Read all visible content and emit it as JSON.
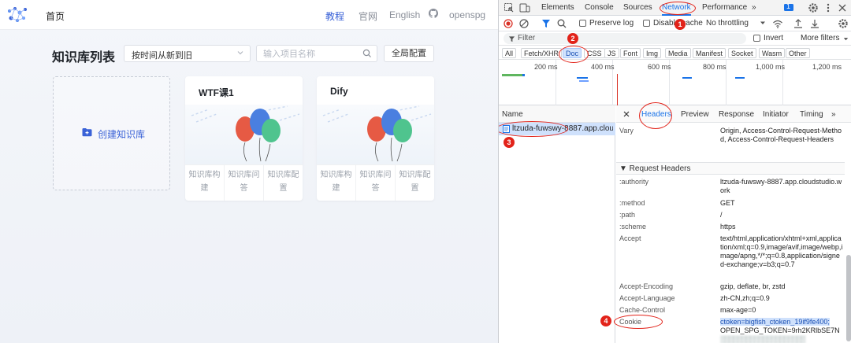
{
  "app": {
    "nav": {
      "home": "首页",
      "tutorial": "教程",
      "site": "官网",
      "lang": "English",
      "openspg": "openspg"
    },
    "list_title": "知识库列表",
    "sort_value": "按时间从新到旧",
    "search_placeholder": "输入项目名称",
    "global_config": "全局配置",
    "create_label": "创建知识库",
    "cards": [
      {
        "name": "WTF课1",
        "actions": [
          "知识库构建",
          "知识库问答",
          "知识库配置"
        ]
      },
      {
        "name": "Dify",
        "actions": [
          "知识库构建",
          "知识库问答",
          "知识库配置"
        ]
      }
    ],
    "colors": {
      "accent": "#3a62d7"
    }
  },
  "devtools": {
    "tabs": [
      "Elements",
      "Console",
      "Sources",
      "Network",
      "Performance",
      "»"
    ],
    "active_tab": "Network",
    "issue_badge": "1",
    "toolbar": {
      "preserve_log": "Preserve log",
      "disable_cache": "Disable cache",
      "throttling": "No throttling"
    },
    "filter": {
      "placeholder": "Filter",
      "invert": "Invert",
      "more_filters": "More filters"
    },
    "types": [
      "All",
      "Fetch/XHR",
      "Doc",
      "CSS",
      "JS",
      "Font",
      "Img",
      "Media",
      "Manifest",
      "Socket",
      "Wasm",
      "Other"
    ],
    "active_type": "Doc",
    "timeline_labels": [
      "200 ms",
      "400 ms",
      "600 ms",
      "800 ms",
      "1,000 ms",
      "1,200 ms"
    ],
    "name_header": "Name",
    "request_name": "ltzuda-fuwswy-8887.app.clou...",
    "detail_tabs": [
      "Headers",
      "Preview",
      "Response",
      "Initiator",
      "Timing",
      "»"
    ],
    "active_detail_tab": "Headers",
    "vary": {
      "key": "Vary",
      "value": "Origin, Access-Control-Request-Method, Access-Control-Request-Headers"
    },
    "request_headers_title": "▼ Request Headers",
    "request_headers": [
      {
        "key": ":authority",
        "value": "ltzuda-fuwswy-8887.app.cloudstudio.work"
      },
      {
        "key": ":method",
        "value": "GET"
      },
      {
        "key": ":path",
        "value": "/"
      },
      {
        "key": ":scheme",
        "value": "https"
      },
      {
        "key": "Accept",
        "value": "text/html,application/xhtml+xml,application/xml;q=0.9,image/avif,image/webp,image/apng,*/*;q=0.8,application/signed-exchange;v=b3;q=0.7"
      },
      {
        "key": "Accept-Encoding",
        "value": "gzip, deflate, br, zstd"
      },
      {
        "key": "Accept-Language",
        "value": "zh-CN,zh;q=0.9"
      },
      {
        "key": "Cache-Control",
        "value": "max-age=0"
      },
      {
        "key": "Cookie",
        "value": "ctoken=bigfish_ctoken_19if9fe400;"
      }
    ],
    "cookie_line2": "OPEN_SPG_TOKEN=9rh2KRlbSE7N",
    "cookie_line3": "▒▒▒▒▒▒▒▒▒▒▒▒▒▒▒▒▒▒▒▒",
    "annotations": [
      "1",
      "2",
      "3",
      "4"
    ],
    "colors": {
      "accent": "#1a73e8",
      "annotation": "#e2231a"
    }
  }
}
